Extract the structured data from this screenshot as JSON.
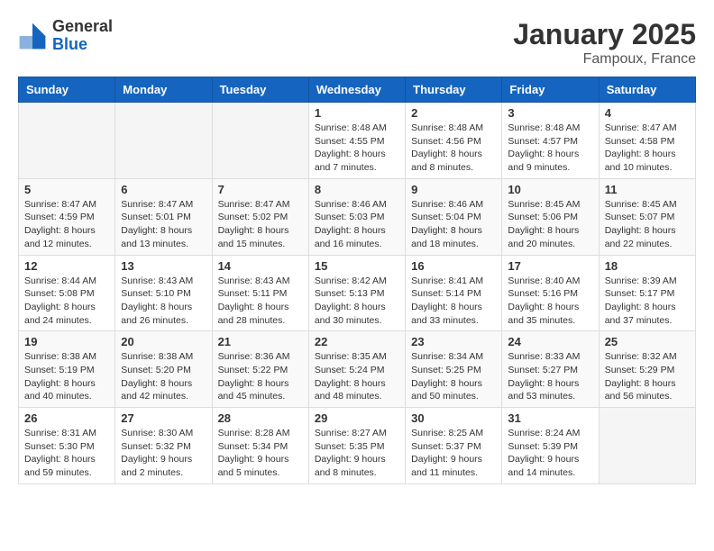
{
  "header": {
    "logo_general": "General",
    "logo_blue": "Blue",
    "month": "January 2025",
    "location": "Fampoux, France"
  },
  "weekdays": [
    "Sunday",
    "Monday",
    "Tuesday",
    "Wednesday",
    "Thursday",
    "Friday",
    "Saturday"
  ],
  "weeks": [
    [
      {
        "day": "",
        "info": ""
      },
      {
        "day": "",
        "info": ""
      },
      {
        "day": "",
        "info": ""
      },
      {
        "day": "1",
        "info": "Sunrise: 8:48 AM\nSunset: 4:55 PM\nDaylight: 8 hours\nand 7 minutes."
      },
      {
        "day": "2",
        "info": "Sunrise: 8:48 AM\nSunset: 4:56 PM\nDaylight: 8 hours\nand 8 minutes."
      },
      {
        "day": "3",
        "info": "Sunrise: 8:48 AM\nSunset: 4:57 PM\nDaylight: 8 hours\nand 9 minutes."
      },
      {
        "day": "4",
        "info": "Sunrise: 8:47 AM\nSunset: 4:58 PM\nDaylight: 8 hours\nand 10 minutes."
      }
    ],
    [
      {
        "day": "5",
        "info": "Sunrise: 8:47 AM\nSunset: 4:59 PM\nDaylight: 8 hours\nand 12 minutes."
      },
      {
        "day": "6",
        "info": "Sunrise: 8:47 AM\nSunset: 5:01 PM\nDaylight: 8 hours\nand 13 minutes."
      },
      {
        "day": "7",
        "info": "Sunrise: 8:47 AM\nSunset: 5:02 PM\nDaylight: 8 hours\nand 15 minutes."
      },
      {
        "day": "8",
        "info": "Sunrise: 8:46 AM\nSunset: 5:03 PM\nDaylight: 8 hours\nand 16 minutes."
      },
      {
        "day": "9",
        "info": "Sunrise: 8:46 AM\nSunset: 5:04 PM\nDaylight: 8 hours\nand 18 minutes."
      },
      {
        "day": "10",
        "info": "Sunrise: 8:45 AM\nSunset: 5:06 PM\nDaylight: 8 hours\nand 20 minutes."
      },
      {
        "day": "11",
        "info": "Sunrise: 8:45 AM\nSunset: 5:07 PM\nDaylight: 8 hours\nand 22 minutes."
      }
    ],
    [
      {
        "day": "12",
        "info": "Sunrise: 8:44 AM\nSunset: 5:08 PM\nDaylight: 8 hours\nand 24 minutes."
      },
      {
        "day": "13",
        "info": "Sunrise: 8:43 AM\nSunset: 5:10 PM\nDaylight: 8 hours\nand 26 minutes."
      },
      {
        "day": "14",
        "info": "Sunrise: 8:43 AM\nSunset: 5:11 PM\nDaylight: 8 hours\nand 28 minutes."
      },
      {
        "day": "15",
        "info": "Sunrise: 8:42 AM\nSunset: 5:13 PM\nDaylight: 8 hours\nand 30 minutes."
      },
      {
        "day": "16",
        "info": "Sunrise: 8:41 AM\nSunset: 5:14 PM\nDaylight: 8 hours\nand 33 minutes."
      },
      {
        "day": "17",
        "info": "Sunrise: 8:40 AM\nSunset: 5:16 PM\nDaylight: 8 hours\nand 35 minutes."
      },
      {
        "day": "18",
        "info": "Sunrise: 8:39 AM\nSunset: 5:17 PM\nDaylight: 8 hours\nand 37 minutes."
      }
    ],
    [
      {
        "day": "19",
        "info": "Sunrise: 8:38 AM\nSunset: 5:19 PM\nDaylight: 8 hours\nand 40 minutes."
      },
      {
        "day": "20",
        "info": "Sunrise: 8:38 AM\nSunset: 5:20 PM\nDaylight: 8 hours\nand 42 minutes."
      },
      {
        "day": "21",
        "info": "Sunrise: 8:36 AM\nSunset: 5:22 PM\nDaylight: 8 hours\nand 45 minutes."
      },
      {
        "day": "22",
        "info": "Sunrise: 8:35 AM\nSunset: 5:24 PM\nDaylight: 8 hours\nand 48 minutes."
      },
      {
        "day": "23",
        "info": "Sunrise: 8:34 AM\nSunset: 5:25 PM\nDaylight: 8 hours\nand 50 minutes."
      },
      {
        "day": "24",
        "info": "Sunrise: 8:33 AM\nSunset: 5:27 PM\nDaylight: 8 hours\nand 53 minutes."
      },
      {
        "day": "25",
        "info": "Sunrise: 8:32 AM\nSunset: 5:29 PM\nDaylight: 8 hours\nand 56 minutes."
      }
    ],
    [
      {
        "day": "26",
        "info": "Sunrise: 8:31 AM\nSunset: 5:30 PM\nDaylight: 8 hours\nand 59 minutes."
      },
      {
        "day": "27",
        "info": "Sunrise: 8:30 AM\nSunset: 5:32 PM\nDaylight: 9 hours\nand 2 minutes."
      },
      {
        "day": "28",
        "info": "Sunrise: 8:28 AM\nSunset: 5:34 PM\nDaylight: 9 hours\nand 5 minutes."
      },
      {
        "day": "29",
        "info": "Sunrise: 8:27 AM\nSunset: 5:35 PM\nDaylight: 9 hours\nand 8 minutes."
      },
      {
        "day": "30",
        "info": "Sunrise: 8:25 AM\nSunset: 5:37 PM\nDaylight: 9 hours\nand 11 minutes."
      },
      {
        "day": "31",
        "info": "Sunrise: 8:24 AM\nSunset: 5:39 PM\nDaylight: 9 hours\nand 14 minutes."
      },
      {
        "day": "",
        "info": ""
      }
    ]
  ]
}
